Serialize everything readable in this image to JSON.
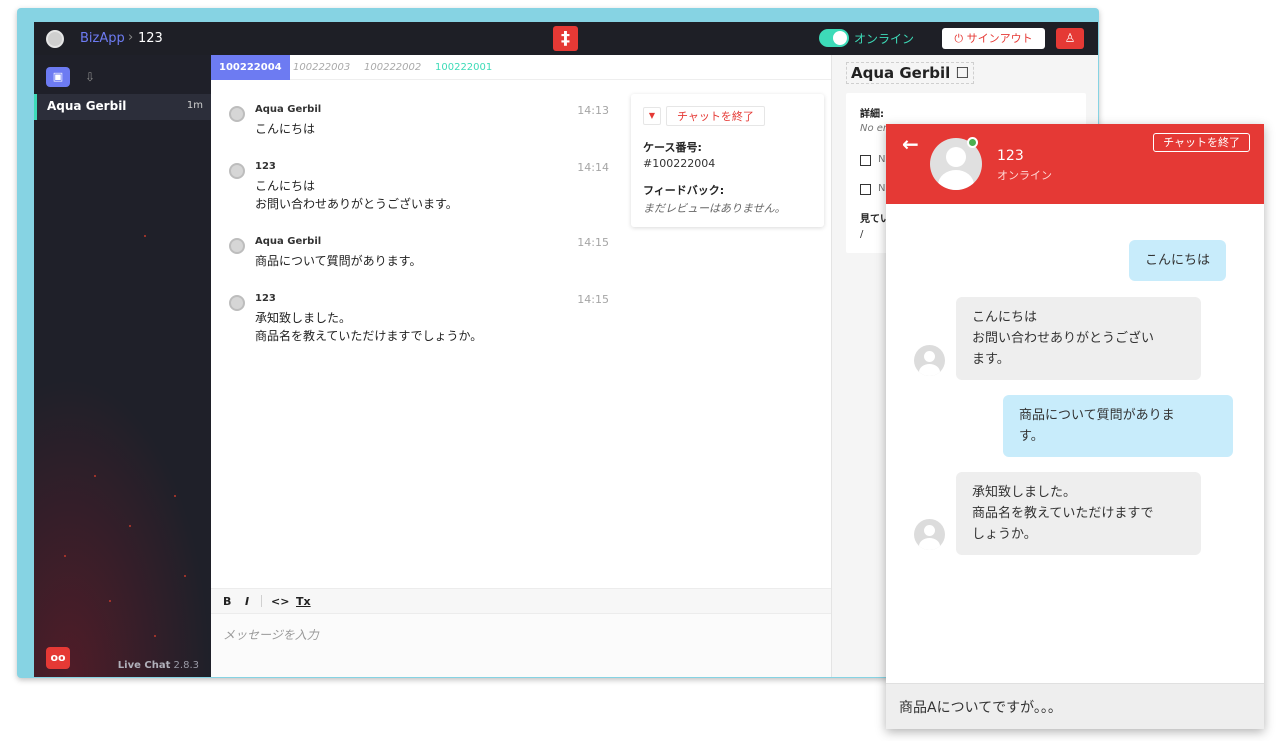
{
  "topbar": {
    "app_name": "BizApp",
    "separator": "›",
    "current": "123",
    "status_label": "オンライン",
    "signout_label": "サインアウト"
  },
  "sidebar": {
    "contact": {
      "name": "Aqua Gerbil",
      "time": "1m"
    },
    "footer_app": "Live Chat",
    "footer_version": "2.8.3"
  },
  "tabs": [
    {
      "label": "100222004",
      "state": "active"
    },
    {
      "label": "100222003",
      "state": "closed"
    },
    {
      "label": "100222002",
      "state": "closed"
    },
    {
      "label": "100222001",
      "state": "open"
    }
  ],
  "messages": [
    {
      "sender": "Aqua Gerbil",
      "time": "14:13",
      "text": "こんにちは"
    },
    {
      "sender": "123",
      "time": "14:14",
      "text": "こんにちは\nお問い合わせありがとうございます。"
    },
    {
      "sender": "Aqua Gerbil",
      "time": "14:15",
      "text": "商品について質問があります。"
    },
    {
      "sender": "123",
      "time": "14:15",
      "text": "承知致しました。\n商品名を教えていただけますでしょうか。"
    }
  ],
  "case_card": {
    "end_label": "チャットを終了",
    "case_number_label": "ケース番号:",
    "case_number": "#100222004",
    "feedback_label": "フィードバック:",
    "feedback_value": "まだレビューはありません。"
  },
  "composer": {
    "bold": "B",
    "italic": "I",
    "code": "<>",
    "clear": "Tx",
    "placeholder": "メッセージを入力"
  },
  "details": {
    "title": "Aqua Gerbil ☐",
    "details_label": "詳細:",
    "email_partial": "No em",
    "check1_partial": "N",
    "check2_partial": "N",
    "viewing_label": "見てい",
    "viewing_value": "/"
  },
  "widget": {
    "back": "←",
    "end_label": "チャットを終了",
    "agent_name": "123",
    "agent_status": "オンライン",
    "bubbles": [
      {
        "from": "me",
        "text": "こんにちは"
      },
      {
        "from": "them",
        "text": "こんにちは\nお問い合わせありがとうござい\nます。"
      },
      {
        "from": "me",
        "text": "商品について質問がありま\nす。"
      },
      {
        "from": "them",
        "text": "承知致しました。\n商品名を教えていただけますで\nしょうか。"
      }
    ],
    "input_text": "商品Aについてですが。。。"
  },
  "colors": {
    "accent_red": "#e53935",
    "accent_teal": "#3ddbb8",
    "accent_indigo": "#6d7bf2",
    "sidebar_bg": "#1f2029"
  },
  "icons": [
    "user-avatar-icon",
    "chevron-right-icon",
    "cross-logo-icon",
    "power-icon",
    "user-icon",
    "chat-icon",
    "inbox-icon",
    "owl-logo-icon",
    "caret-down-icon",
    "back-arrow-icon",
    "checkbox-icon"
  ]
}
